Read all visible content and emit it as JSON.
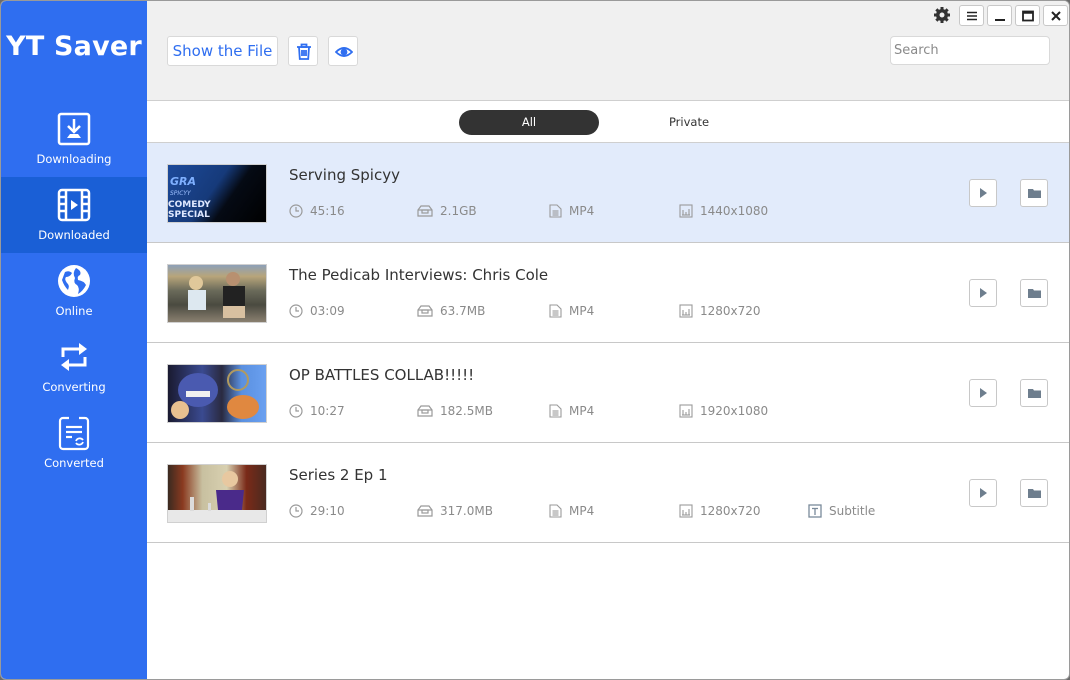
{
  "app": {
    "title": "YT Saver",
    "accent": "#2f6ef0"
  },
  "sidebar": {
    "items": [
      {
        "label": "Downloading",
        "icon": "download-icon",
        "active": false
      },
      {
        "label": "Downloaded",
        "icon": "film-icon",
        "active": true
      },
      {
        "label": "Online",
        "icon": "globe-icon",
        "active": false
      },
      {
        "label": "Converting",
        "icon": "convert-arrows-icon",
        "active": false
      },
      {
        "label": "Converted",
        "icon": "converted-document-icon",
        "active": false
      }
    ]
  },
  "toolbar": {
    "show_file_label": "Show the File",
    "delete_icon": "trash-icon",
    "preview_icon": "eye-icon",
    "search_placeholder": "Search",
    "search_value": ""
  },
  "window_controls": {
    "settings": "gear-icon",
    "menu": "menu-icon",
    "minimize": "minimize-icon",
    "maximize": "maximize-icon",
    "close": "close-icon"
  },
  "tabs": [
    {
      "label": "All",
      "active": true
    },
    {
      "label": "Private",
      "active": false
    }
  ],
  "videos": [
    {
      "title": "Serving Spicyy",
      "duration": "45:16",
      "size": "2.1GB",
      "format": "MP4",
      "resolution": "1440x1080",
      "subtitle": null,
      "selected": true
    },
    {
      "title": "The Pedicab Interviews: Chris Cole",
      "duration": "03:09",
      "size": "63.7MB",
      "format": "MP4",
      "resolution": "1280x720",
      "subtitle": null,
      "selected": false
    },
    {
      "title": "OP BATTLES COLLAB!!!!!",
      "duration": "10:27",
      "size": "182.5MB",
      "format": "MP4",
      "resolution": "1920x1080",
      "subtitle": null,
      "selected": false
    },
    {
      "title": "Series 2 Ep 1",
      "duration": "29:10",
      "size": "317.0MB",
      "format": "MP4",
      "resolution": "1280x720",
      "subtitle": "Subtitle",
      "selected": false
    }
  ]
}
